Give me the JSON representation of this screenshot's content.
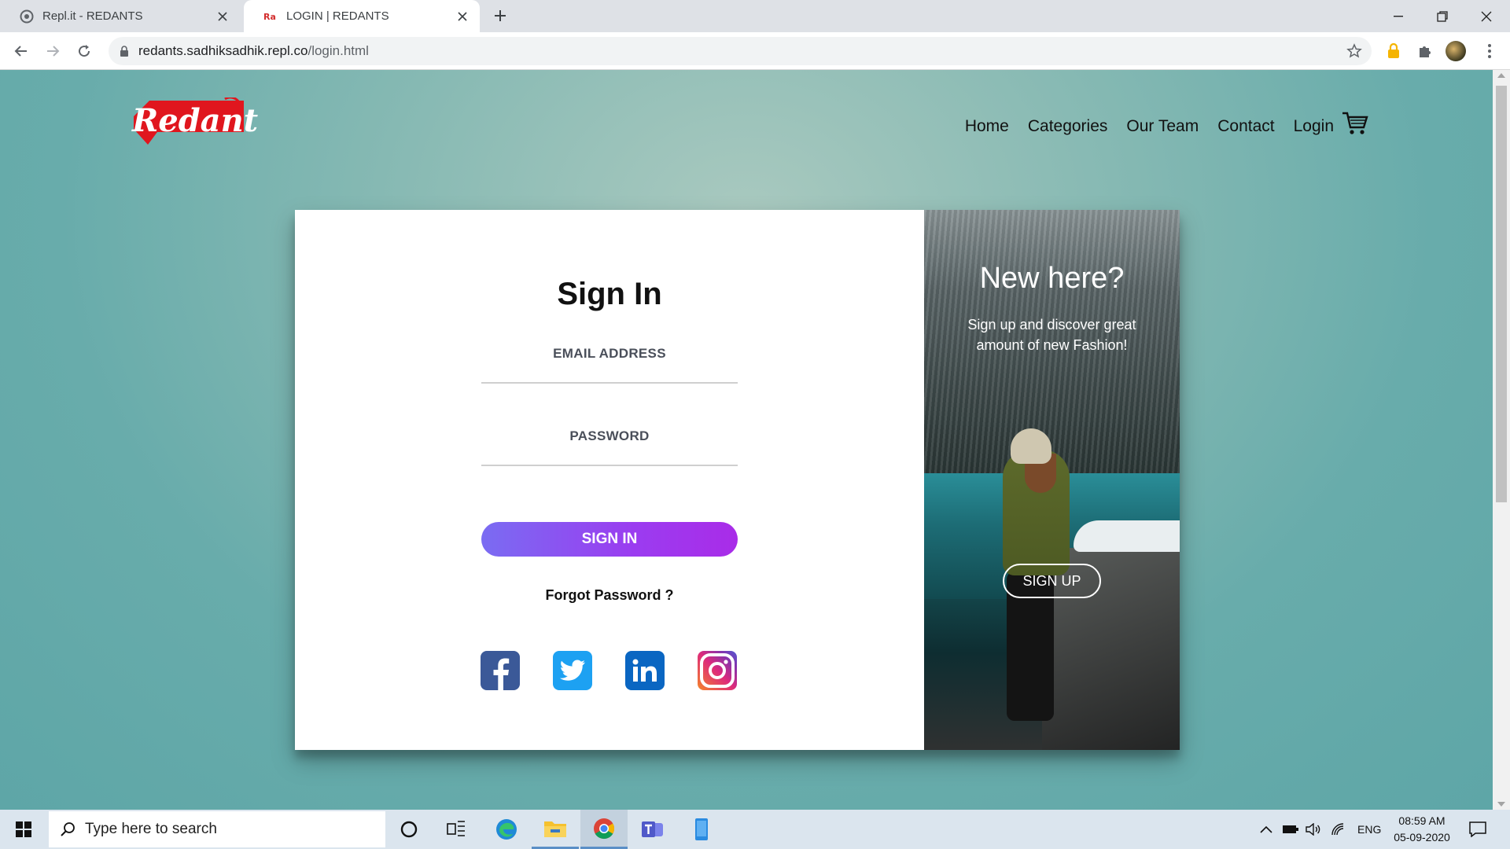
{
  "browser": {
    "tabs": [
      {
        "title": "Repl.it - REDANTS",
        "active": false
      },
      {
        "title": "LOGIN | REDANTS",
        "active": true
      }
    ],
    "url_host": "redants.sadhiksadhik.repl.co",
    "url_path": "/login.html"
  },
  "site": {
    "brand": "Redant",
    "nav": [
      "Home",
      "Categories",
      "Our Team",
      "Contact",
      "Login"
    ]
  },
  "signin": {
    "heading": "Sign In",
    "email_label": "EMAIL ADDRESS",
    "password_label": "PASSWORD",
    "button": "SIGN IN",
    "forgot": "Forgot Password ?",
    "social": [
      "facebook-icon",
      "twitter-icon",
      "linkedin-icon",
      "instagram-icon"
    ]
  },
  "signup_panel": {
    "heading": "New here?",
    "blurb": "Sign up and discover great amount of new Fashion!",
    "button": "SIGN UP"
  },
  "taskbar": {
    "search_placeholder": "Type here to search",
    "language": "ENG",
    "time": "08:59 AM",
    "date": "05-09-2020"
  },
  "colors": {
    "accent_gradient_start": "#7a6cf2",
    "accent_gradient_end": "#a92ce8",
    "page_bg": "#68acab"
  }
}
